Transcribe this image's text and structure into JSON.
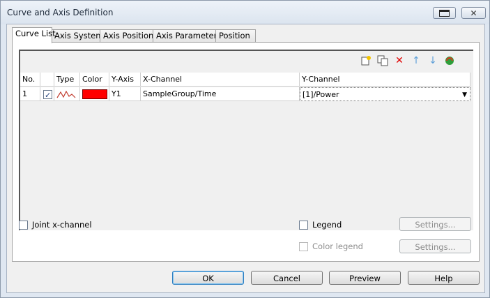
{
  "window": {
    "title": "Curve and Axis Definition"
  },
  "tabs": [
    "Curve List",
    "Axis System",
    "Axis Position",
    "Axis Parameters",
    "Position"
  ],
  "toolbar": {
    "icons": [
      "new-curve-icon",
      "copy-curve-icon",
      "delete-icon",
      "move-up-icon",
      "move-down-icon",
      "refresh-icon"
    ]
  },
  "grid": {
    "headers": [
      "No.",
      "",
      "Type",
      "Color",
      "Y-Axis",
      "X-Channel",
      "Y-Channel"
    ],
    "rows": [
      {
        "no": "1",
        "checked": true,
        "type_icon": "curve-type-icon",
        "color": "#ff0000",
        "y_axis": "Y1",
        "x_channel": "SampleGroup/Time",
        "y_channel": "[1]/Power"
      }
    ]
  },
  "options": {
    "joint_x_channel": "Joint x-channel",
    "legend": "Legend",
    "color_legend": "Color legend",
    "settings1": "Settings...",
    "settings2": "Settings..."
  },
  "buttons": {
    "ok": "OK",
    "cancel": "Cancel",
    "preview": "Preview",
    "help": "Help"
  }
}
